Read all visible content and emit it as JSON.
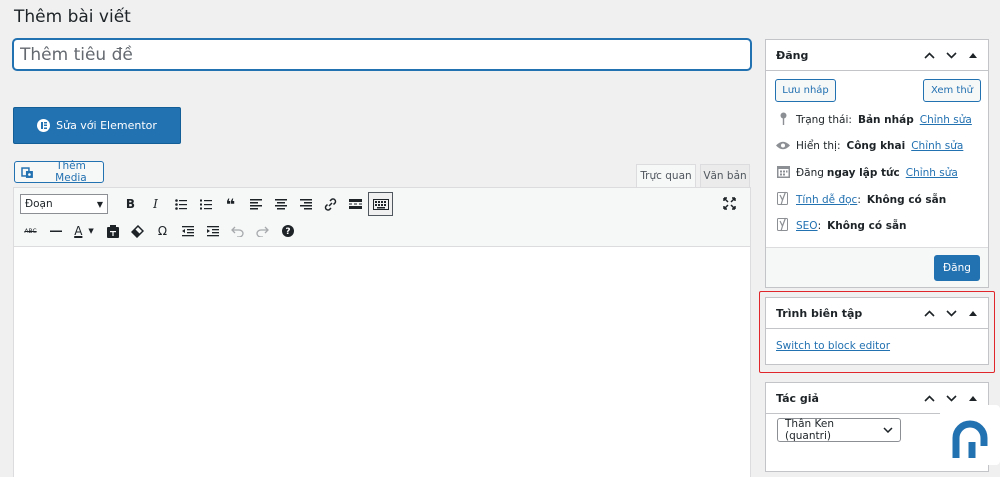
{
  "page": {
    "title": "Thêm bài viết"
  },
  "title_field": {
    "placeholder": "Thêm tiêu đề"
  },
  "elementor": {
    "label": "Sửa với Elementor"
  },
  "media": {
    "label": "Thêm Media"
  },
  "editor_tabs": [
    {
      "label": "Trực quan",
      "active": true
    },
    {
      "label": "Văn bản",
      "active": false
    }
  ],
  "toolbar": {
    "format_value": "Đoạn",
    "row1_icons": [
      "bold-icon",
      "italic-icon",
      "bullet-list-icon",
      "numbered-list-icon",
      "blockquote-icon",
      "align-left-icon",
      "align-center-icon",
      "align-right-icon",
      "link-icon",
      "read-more-icon",
      "toolbar-toggle-icon"
    ],
    "row2_icons": [
      "strikethrough-icon",
      "horizontal-line-icon",
      "text-color-icon",
      "paste-text-icon",
      "clear-formatting-icon",
      "special-character-icon",
      "outdent-icon",
      "indent-icon",
      "undo-icon",
      "redo-icon",
      "help-icon"
    ],
    "glyphs": {
      "bold": "B",
      "italic": "I",
      "text_color": "A",
      "omega": "Ω",
      "strikethrough": "ABC"
    }
  },
  "publish_box": {
    "title": "Đăng",
    "save_draft": "Lưu nháp",
    "preview": "Xem thử",
    "status_label": "Trạng thái:",
    "status_value": "Bản nháp",
    "edit": "Chỉnh sửa",
    "visibility_label": "Hiển thị:",
    "visibility_value": "Công khai",
    "schedule_label": "Đăng",
    "schedule_value": "ngay lập tức",
    "readability_label": "Tính dễ đọc",
    "readability_value": "Không có sẵn",
    "seo_label": "SEO",
    "seo_value": "Không có sẵn",
    "colon": ":",
    "publish": "Đăng"
  },
  "editor_box": {
    "title": "Trình biên tập",
    "link": "Switch to block editor"
  },
  "author_box": {
    "title": "Tác giả",
    "value": "Thân Ken (quantri)"
  },
  "colors": {
    "accent": "#2271b1",
    "highlight": "#e0262a",
    "background": "#f0f0f1"
  }
}
